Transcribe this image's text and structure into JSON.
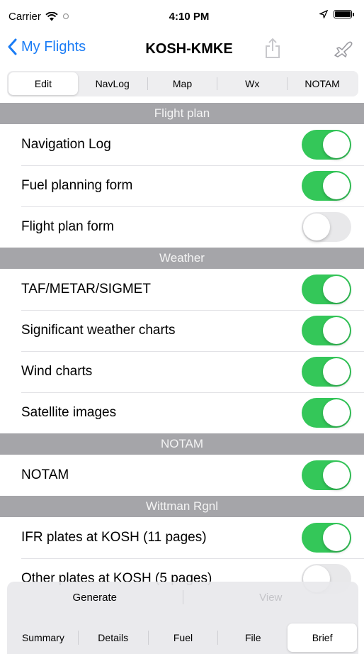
{
  "status_bar": {
    "carrier": "Carrier",
    "time": "4:10 PM"
  },
  "nav": {
    "back_label": "My Flights",
    "title": "KOSH-KMKE"
  },
  "tabs": [
    {
      "label": "Edit",
      "selected": true
    },
    {
      "label": "NavLog",
      "selected": false
    },
    {
      "label": "Map",
      "selected": false
    },
    {
      "label": "Wx",
      "selected": false
    },
    {
      "label": "NOTAM",
      "selected": false
    }
  ],
  "sections": [
    {
      "title": "Flight plan",
      "rows": [
        {
          "label": "Navigation Log",
          "on": true
        },
        {
          "label": "Fuel planning form",
          "on": true
        },
        {
          "label": "Flight plan form",
          "on": false
        }
      ]
    },
    {
      "title": "Weather",
      "rows": [
        {
          "label": "TAF/METAR/SIGMET",
          "on": true
        },
        {
          "label": "Significant weather charts",
          "on": true
        },
        {
          "label": "Wind charts",
          "on": true
        },
        {
          "label": "Satellite images",
          "on": true
        }
      ]
    },
    {
      "title": "NOTAM",
      "rows": [
        {
          "label": "NOTAM",
          "on": true
        }
      ]
    },
    {
      "title": "Wittman Rgnl",
      "rows": [
        {
          "label": "IFR plates at KOSH (11 pages)",
          "on": true
        },
        {
          "label": "Other plates at KOSH (5 pages)",
          "on": false
        }
      ]
    }
  ],
  "actions": {
    "generate": "Generate",
    "view": "View"
  },
  "bottom_tabs": [
    {
      "label": "Summary",
      "selected": false
    },
    {
      "label": "Details",
      "selected": false
    },
    {
      "label": "Fuel",
      "selected": false
    },
    {
      "label": "File",
      "selected": false
    },
    {
      "label": "Brief",
      "selected": true
    }
  ],
  "colors": {
    "accent": "#1a7cf5",
    "toggle_on": "#34c759",
    "section_header": "#a5a5a9"
  }
}
